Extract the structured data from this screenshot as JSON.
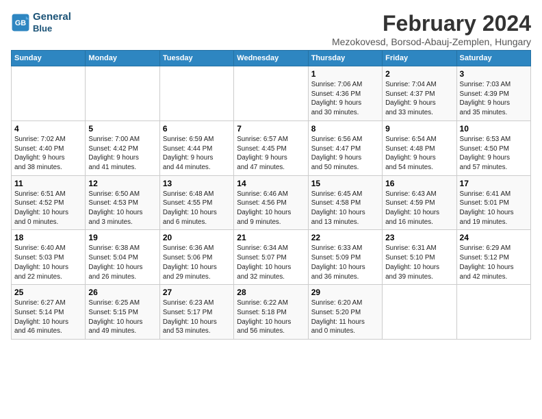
{
  "header": {
    "title": "February 2024",
    "subtitle": "Mezokovesd, Borsod-Abauj-Zemplen, Hungary",
    "logo_line1": "General",
    "logo_line2": "Blue"
  },
  "weekdays": [
    "Sunday",
    "Monday",
    "Tuesday",
    "Wednesday",
    "Thursday",
    "Friday",
    "Saturday"
  ],
  "weeks": [
    [
      {
        "day": "",
        "info": ""
      },
      {
        "day": "",
        "info": ""
      },
      {
        "day": "",
        "info": ""
      },
      {
        "day": "",
        "info": ""
      },
      {
        "day": "1",
        "info": "Sunrise: 7:06 AM\nSunset: 4:36 PM\nDaylight: 9 hours\nand 30 minutes."
      },
      {
        "day": "2",
        "info": "Sunrise: 7:04 AM\nSunset: 4:37 PM\nDaylight: 9 hours\nand 33 minutes."
      },
      {
        "day": "3",
        "info": "Sunrise: 7:03 AM\nSunset: 4:39 PM\nDaylight: 9 hours\nand 35 minutes."
      }
    ],
    [
      {
        "day": "4",
        "info": "Sunrise: 7:02 AM\nSunset: 4:40 PM\nDaylight: 9 hours\nand 38 minutes."
      },
      {
        "day": "5",
        "info": "Sunrise: 7:00 AM\nSunset: 4:42 PM\nDaylight: 9 hours\nand 41 minutes."
      },
      {
        "day": "6",
        "info": "Sunrise: 6:59 AM\nSunset: 4:44 PM\nDaylight: 9 hours\nand 44 minutes."
      },
      {
        "day": "7",
        "info": "Sunrise: 6:57 AM\nSunset: 4:45 PM\nDaylight: 9 hours\nand 47 minutes."
      },
      {
        "day": "8",
        "info": "Sunrise: 6:56 AM\nSunset: 4:47 PM\nDaylight: 9 hours\nand 50 minutes."
      },
      {
        "day": "9",
        "info": "Sunrise: 6:54 AM\nSunset: 4:48 PM\nDaylight: 9 hours\nand 54 minutes."
      },
      {
        "day": "10",
        "info": "Sunrise: 6:53 AM\nSunset: 4:50 PM\nDaylight: 9 hours\nand 57 minutes."
      }
    ],
    [
      {
        "day": "11",
        "info": "Sunrise: 6:51 AM\nSunset: 4:52 PM\nDaylight: 10 hours\nand 0 minutes."
      },
      {
        "day": "12",
        "info": "Sunrise: 6:50 AM\nSunset: 4:53 PM\nDaylight: 10 hours\nand 3 minutes."
      },
      {
        "day": "13",
        "info": "Sunrise: 6:48 AM\nSunset: 4:55 PM\nDaylight: 10 hours\nand 6 minutes."
      },
      {
        "day": "14",
        "info": "Sunrise: 6:46 AM\nSunset: 4:56 PM\nDaylight: 10 hours\nand 9 minutes."
      },
      {
        "day": "15",
        "info": "Sunrise: 6:45 AM\nSunset: 4:58 PM\nDaylight: 10 hours\nand 13 minutes."
      },
      {
        "day": "16",
        "info": "Sunrise: 6:43 AM\nSunset: 4:59 PM\nDaylight: 10 hours\nand 16 minutes."
      },
      {
        "day": "17",
        "info": "Sunrise: 6:41 AM\nSunset: 5:01 PM\nDaylight: 10 hours\nand 19 minutes."
      }
    ],
    [
      {
        "day": "18",
        "info": "Sunrise: 6:40 AM\nSunset: 5:03 PM\nDaylight: 10 hours\nand 22 minutes."
      },
      {
        "day": "19",
        "info": "Sunrise: 6:38 AM\nSunset: 5:04 PM\nDaylight: 10 hours\nand 26 minutes."
      },
      {
        "day": "20",
        "info": "Sunrise: 6:36 AM\nSunset: 5:06 PM\nDaylight: 10 hours\nand 29 minutes."
      },
      {
        "day": "21",
        "info": "Sunrise: 6:34 AM\nSunset: 5:07 PM\nDaylight: 10 hours\nand 32 minutes."
      },
      {
        "day": "22",
        "info": "Sunrise: 6:33 AM\nSunset: 5:09 PM\nDaylight: 10 hours\nand 36 minutes."
      },
      {
        "day": "23",
        "info": "Sunrise: 6:31 AM\nSunset: 5:10 PM\nDaylight: 10 hours\nand 39 minutes."
      },
      {
        "day": "24",
        "info": "Sunrise: 6:29 AM\nSunset: 5:12 PM\nDaylight: 10 hours\nand 42 minutes."
      }
    ],
    [
      {
        "day": "25",
        "info": "Sunrise: 6:27 AM\nSunset: 5:14 PM\nDaylight: 10 hours\nand 46 minutes."
      },
      {
        "day": "26",
        "info": "Sunrise: 6:25 AM\nSunset: 5:15 PM\nDaylight: 10 hours\nand 49 minutes."
      },
      {
        "day": "27",
        "info": "Sunrise: 6:23 AM\nSunset: 5:17 PM\nDaylight: 10 hours\nand 53 minutes."
      },
      {
        "day": "28",
        "info": "Sunrise: 6:22 AM\nSunset: 5:18 PM\nDaylight: 10 hours\nand 56 minutes."
      },
      {
        "day": "29",
        "info": "Sunrise: 6:20 AM\nSunset: 5:20 PM\nDaylight: 11 hours\nand 0 minutes."
      },
      {
        "day": "",
        "info": ""
      },
      {
        "day": "",
        "info": ""
      }
    ]
  ]
}
